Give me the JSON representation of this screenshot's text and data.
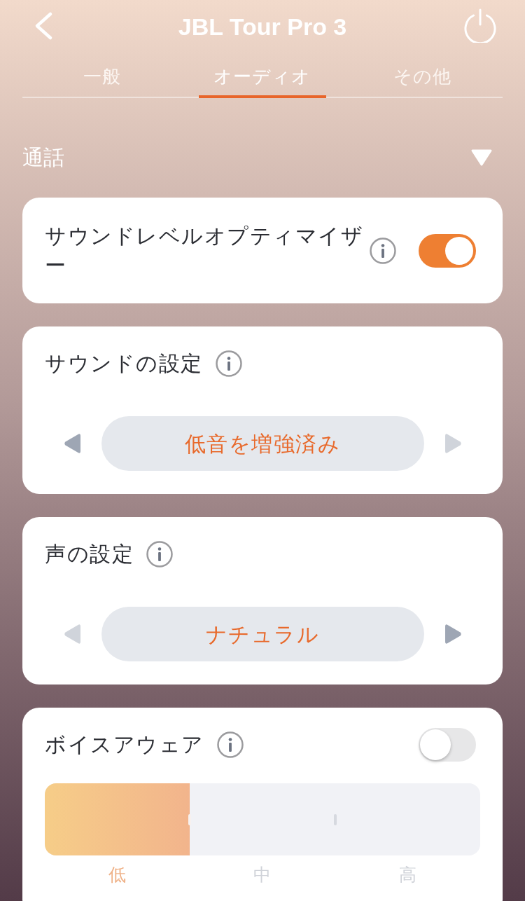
{
  "header": {
    "title": "JBL Tour Pro 3"
  },
  "tabs": [
    {
      "label": "一般",
      "selected": false
    },
    {
      "label": "オーディオ",
      "selected": true
    },
    {
      "label": "その他",
      "selected": false
    }
  ],
  "section": {
    "title": "通話",
    "expanded": true
  },
  "cards": [
    {
      "kind": "toggle",
      "title": "サウンドレベルオプティマイザー",
      "on": true
    },
    {
      "kind": "selector",
      "title": "サウンドの設定",
      "value": "低音を増強済み",
      "prev_disabled": false,
      "next_disabled": true
    },
    {
      "kind": "selector",
      "title": "声の設定",
      "value": "ナチュラル",
      "prev_disabled": true,
      "next_disabled": false
    },
    {
      "kind": "toggle_slider",
      "title": "ボイスアウェア",
      "on": false,
      "level": 0.333,
      "steps": [
        {
          "label": "低",
          "selected": true
        },
        {
          "label": "中",
          "selected": false
        },
        {
          "label": "高",
          "selected": false
        }
      ]
    }
  ]
}
